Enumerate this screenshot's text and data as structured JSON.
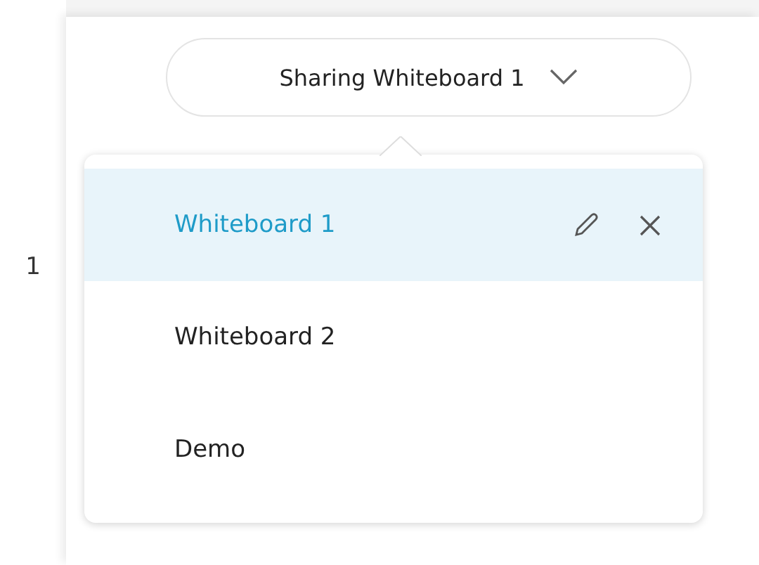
{
  "gutter": {
    "line_number": "1"
  },
  "share_button": {
    "label": "Sharing Whiteboard 1"
  },
  "menu": {
    "items": [
      {
        "label": "Whiteboard 1",
        "selected": true
      },
      {
        "label": "Whiteboard 2",
        "selected": false
      },
      {
        "label": "Demo",
        "selected": false
      }
    ]
  }
}
